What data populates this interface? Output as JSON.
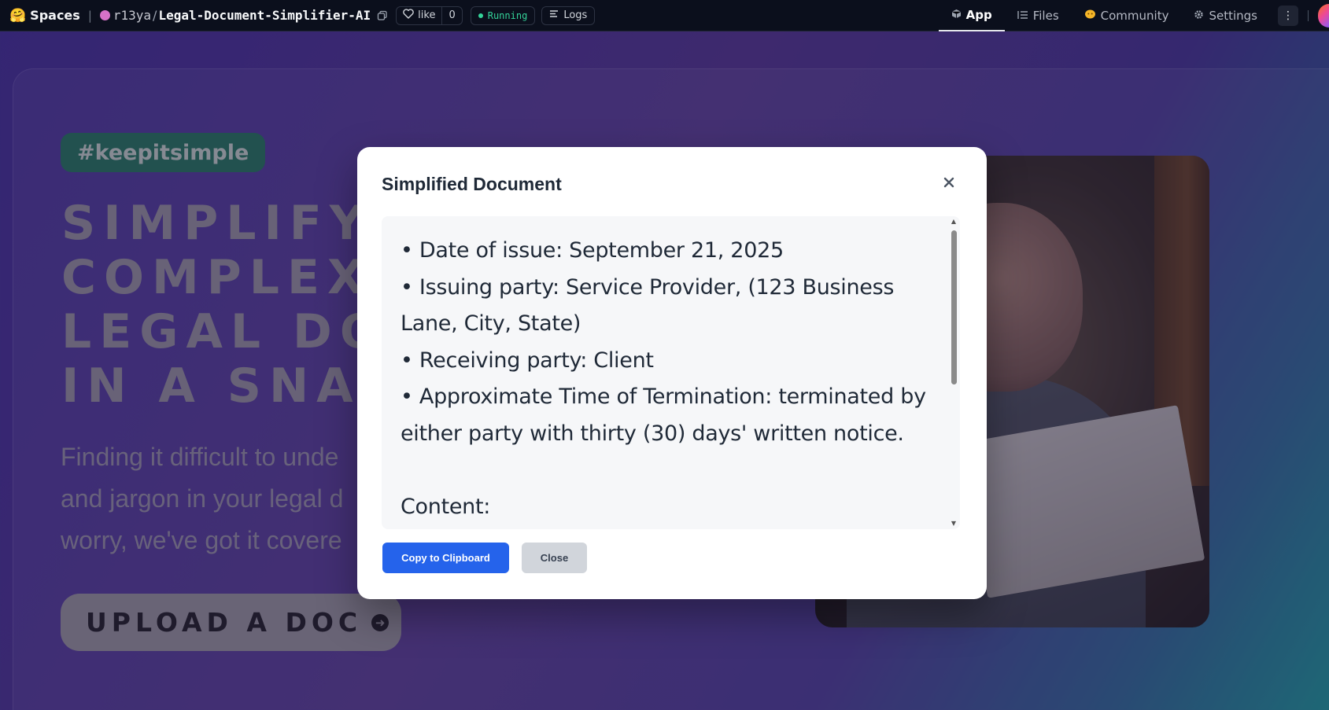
{
  "topbar": {
    "logo_icon": "hugging-face-emoji",
    "spaces_label": "Spaces",
    "owner": "r13ya",
    "slash": "/",
    "repo": "Legal-Document-Simplifier-AI",
    "like_label": "like",
    "like_count": "0",
    "status": "Running",
    "logs_label": "Logs",
    "tabs": [
      {
        "label": "App",
        "icon": "cube-icon",
        "active": true
      },
      {
        "label": "Files",
        "icon": "files-icon",
        "active": false
      },
      {
        "label": "Community",
        "icon": "community-icon",
        "active": false
      },
      {
        "label": "Settings",
        "icon": "gear-icon",
        "active": false
      }
    ]
  },
  "hero": {
    "tag": "#keepitsimple",
    "headline": [
      "SIMPLIFY",
      "COMPLEX",
      "LEGAL  DO",
      "IN  A  SNA"
    ],
    "subtext": [
      "Finding it difficult to unde",
      "and jargon in your legal d",
      "worry, we've got it covere"
    ],
    "upload_label": "UPLOAD  A  DOC"
  },
  "modal": {
    "title": "Simplified Document",
    "lines": [
      "• Date of issue: September 21, 2025",
      "• Issuing party: Service Provider, (123 Business",
      "Lane, City, State)",
      "• Receiving party: Client",
      "• Approximate Time of Termination: terminated by",
      "either party with thirty (30) days' written notice.",
      "",
      "Content:"
    ],
    "copy_label": "Copy to Clipboard",
    "close_label": "Close"
  },
  "colors": {
    "accent_blue": "#2563eb",
    "running_green": "#34d399",
    "tag_green": "#1f6e55"
  }
}
